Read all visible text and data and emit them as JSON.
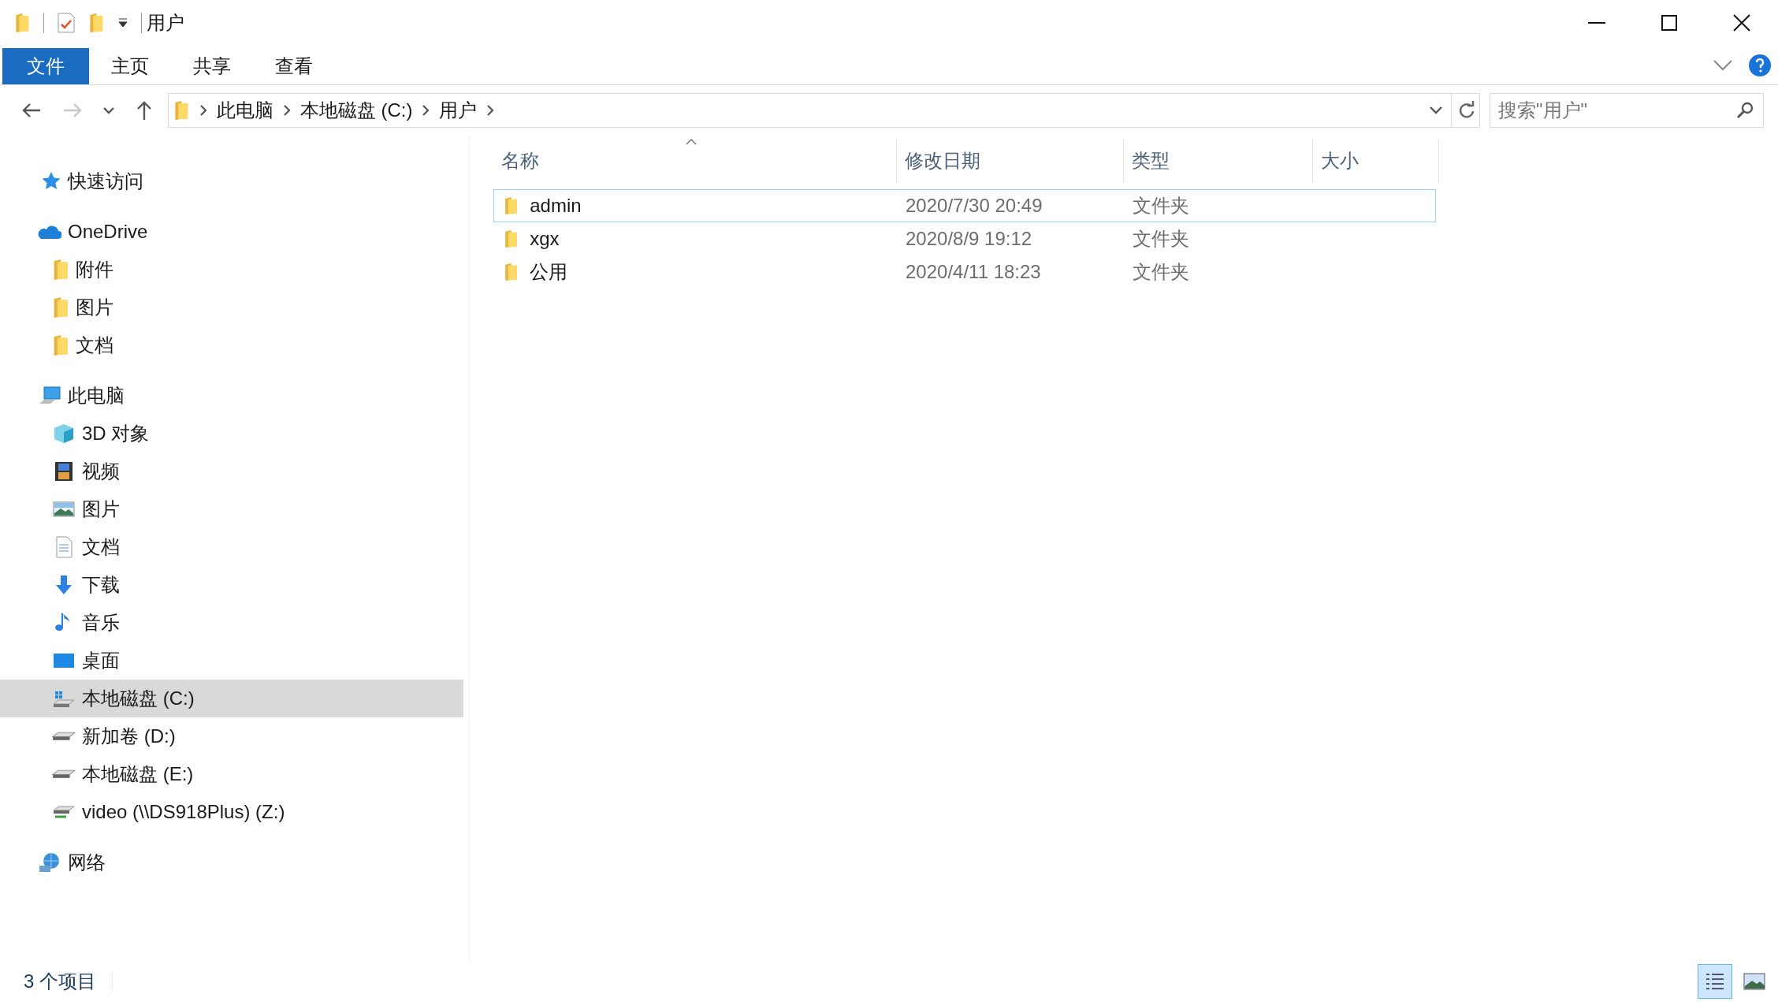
{
  "title_bar": {
    "title": "用户"
  },
  "ribbon": {
    "tabs": [
      {
        "label": "文件",
        "selected": true
      },
      {
        "label": "主页",
        "selected": false
      },
      {
        "label": "共享",
        "selected": false
      },
      {
        "label": "查看",
        "selected": false
      }
    ]
  },
  "navigation": [
    {
      "kind": "back",
      "disabled": false
    },
    {
      "kind": "forward",
      "disabled": true
    },
    {
      "kind": "recent",
      "disabled": false
    },
    {
      "kind": "up",
      "disabled": false
    }
  ],
  "address": {
    "crumbs": [
      "此电脑",
      "本地磁盘 (C:)",
      "用户"
    ]
  },
  "search": {
    "placeholder": "搜索\"用户\""
  },
  "sidebar": {
    "sections": [
      {
        "label": "快速访问",
        "kind": "star",
        "selected": false
      },
      {
        "label": "OneDrive",
        "kind": "cloud",
        "selected": false,
        "children": [
          {
            "label": "附件",
            "kind": "folder",
            "selected": false
          },
          {
            "label": "图片",
            "kind": "folder",
            "selected": false
          },
          {
            "label": "文档",
            "kind": "folder",
            "selected": false
          }
        ]
      },
      {
        "label": "此电脑",
        "kind": "computer",
        "selected": false,
        "children": [
          {
            "label": "3D 对象",
            "kind": "cube",
            "selected": false
          },
          {
            "label": "视频",
            "kind": "film",
            "selected": false
          },
          {
            "label": "图片",
            "kind": "picture",
            "selected": false
          },
          {
            "label": "文档",
            "kind": "document",
            "selected": false
          },
          {
            "label": "下载",
            "kind": "download",
            "selected": false
          },
          {
            "label": "音乐",
            "kind": "music",
            "selected": false
          },
          {
            "label": "桌面",
            "kind": "desktop",
            "selected": false
          },
          {
            "label": "本地磁盘 (C:)",
            "kind": "system-drive",
            "selected": true
          },
          {
            "label": "新加卷 (D:)",
            "kind": "drive",
            "selected": false
          },
          {
            "label": "本地磁盘 (E:)",
            "kind": "drive",
            "selected": false
          },
          {
            "label": "video (\\\\DS918Plus) (Z:)",
            "kind": "network-drive",
            "selected": false
          }
        ]
      },
      {
        "label": "网络",
        "kind": "network",
        "selected": false
      }
    ]
  },
  "table": {
    "columns": [
      "名称",
      "修改日期",
      "类型",
      "大小"
    ],
    "rows": [
      {
        "name": "admin",
        "modified": "2020/7/30 20:49",
        "type": "文件夹",
        "selected": true
      },
      {
        "name": "xgx",
        "modified": "2020/8/9 19:12",
        "type": "文件夹",
        "selected": false
      },
      {
        "name": "公用",
        "modified": "2020/4/11 18:23",
        "type": "文件夹",
        "selected": false
      }
    ]
  },
  "status_bar": {
    "count": "3 个项目",
    "views": [
      {
        "kind": "details",
        "selected": true
      },
      {
        "kind": "large-icons",
        "selected": false
      }
    ]
  }
}
